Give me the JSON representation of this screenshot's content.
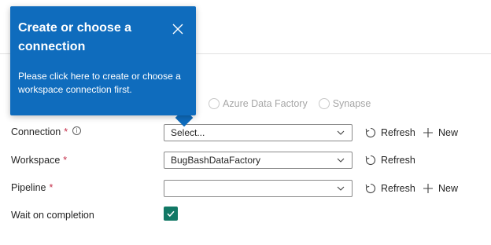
{
  "callout": {
    "title": "Create or choose a connection",
    "body": "Please click here to create or choose a workspace connection first.",
    "close_icon": "close-icon"
  },
  "type_selector": {
    "hidden_label_fragment": "ic",
    "options": [
      "Azure Data Factory",
      "Synapse"
    ]
  },
  "form": {
    "connection": {
      "label": "Connection",
      "required_mark": "*",
      "info_glyph": "i",
      "placeholder": "Select...",
      "refresh_label": "Refresh",
      "new_label": "New"
    },
    "workspace": {
      "label": "Workspace",
      "required_mark": "*",
      "value": "BugBashDataFactory",
      "refresh_label": "Refresh"
    },
    "pipeline": {
      "label": "Pipeline",
      "required_mark": "*",
      "value": "",
      "refresh_label": "Refresh",
      "new_label": "New"
    },
    "wait_on_completion": {
      "label": "Wait on completion",
      "checked": true
    }
  },
  "colors": {
    "callout_bg": "#0f6cbd",
    "checkbox_bg": "#117865",
    "required": "#c4314b"
  }
}
